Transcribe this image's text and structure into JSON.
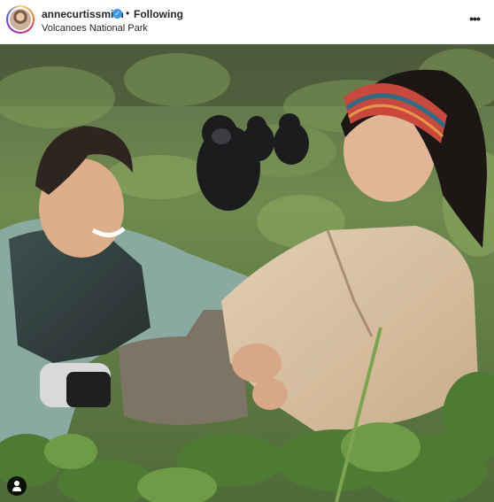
{
  "post": {
    "username": "annecurtissmith",
    "follow_status": "Following",
    "separator": "•",
    "location": "Volcanoes National Park",
    "verified_glyph": "✓",
    "more_glyph": "•••"
  },
  "icons": {
    "verified": "verified-badge-icon",
    "more": "more-options-icon",
    "tagged": "tagged-user-icon"
  },
  "colors": {
    "verified_blue": "#3897f0",
    "text": "#262626",
    "background": "#ffffff"
  }
}
